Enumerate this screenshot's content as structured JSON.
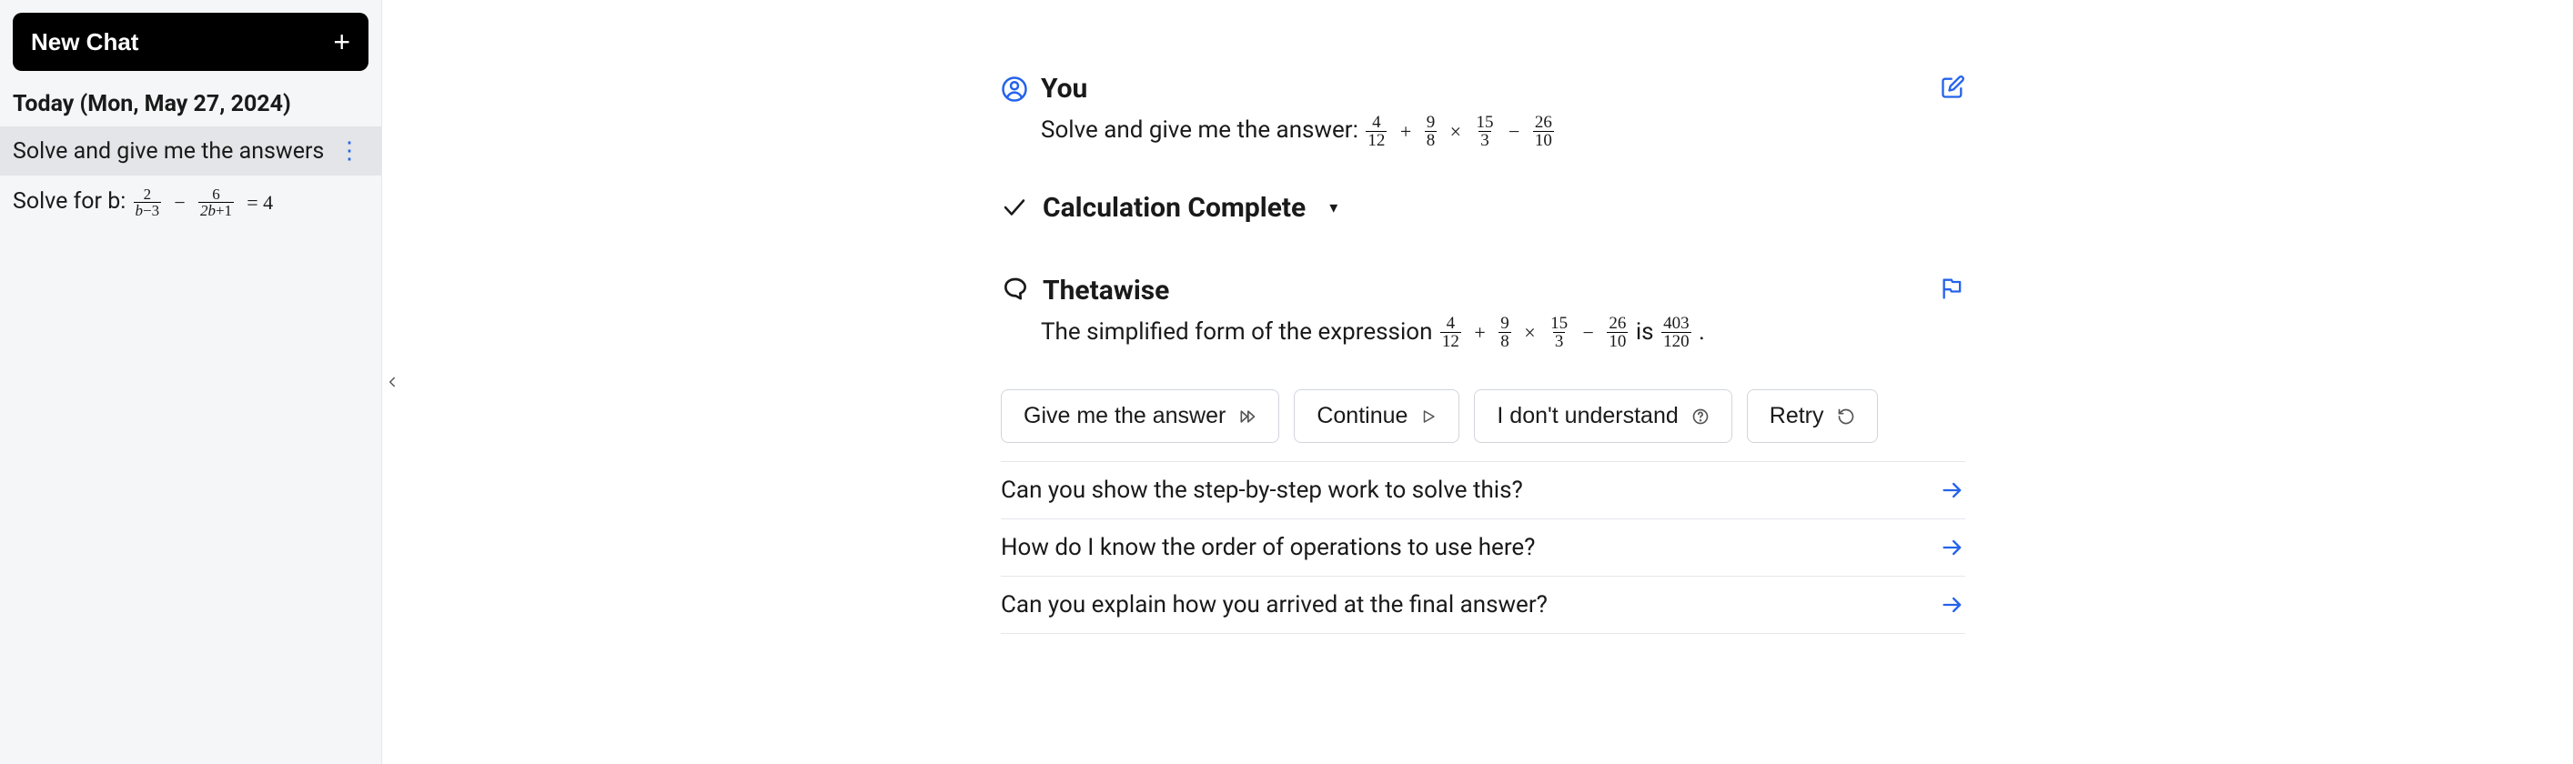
{
  "sidebar": {
    "new_chat_label": "New Chat",
    "date_header": "Today (Mon, May 27, 2024)",
    "items": [
      {
        "prefix": "Solve and give me the answers"
      },
      {
        "prefix": "Solve for b:  "
      }
    ]
  },
  "user_msg": {
    "title": "You",
    "body_prefix": "Solve and give me the answer: "
  },
  "calc": {
    "label": "Calculation Complete"
  },
  "assistant_msg": {
    "title": "Thetawise",
    "body_prefix": "The simplified form of the expression ",
    "body_mid": " is ",
    "body_suffix": "."
  },
  "expression": {
    "terms": [
      {
        "num": "4",
        "den": "12"
      },
      {
        "op": "+"
      },
      {
        "num": "9",
        "den": "8"
      },
      {
        "op": "×"
      },
      {
        "num": "15",
        "den": "3"
      },
      {
        "op": "−"
      },
      {
        "num": "26",
        "den": "10"
      }
    ],
    "result": {
      "num": "403",
      "den": "120"
    }
  },
  "sidebar_eq2": {
    "frac1": {
      "num": "2",
      "den_pre": "b",
      "den_post": "−3"
    },
    "op1": "−",
    "frac2": {
      "num": "6",
      "den_pre": "2b",
      "den_post": "+1"
    },
    "eq": "= 4"
  },
  "buttons": {
    "give_answer": "Give me the answer",
    "continue": "Continue",
    "dont_understand": "I don't understand",
    "retry": "Retry"
  },
  "suggestions": [
    "Can you show the step-by-step work to solve this?",
    "How do I know the order of operations to use here?",
    "Can you explain how you arrived at the final answer?"
  ],
  "colors": {
    "accent": "#2563eb"
  }
}
